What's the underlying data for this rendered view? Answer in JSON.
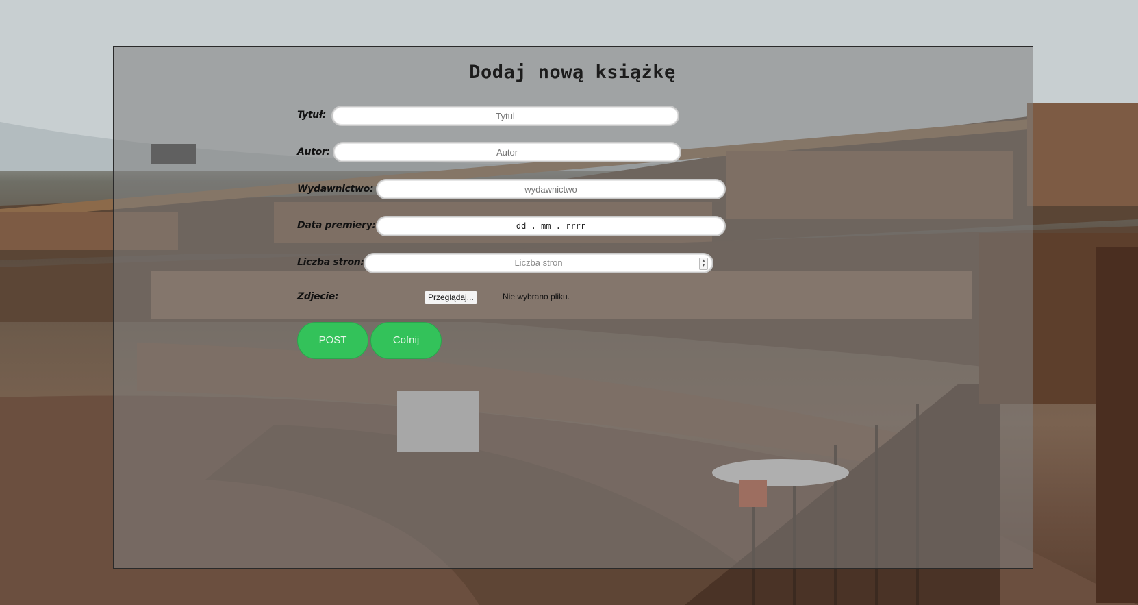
{
  "page": {
    "title": "Dodaj nową książkę"
  },
  "form": {
    "title": {
      "label": "Tytuł:",
      "placeholder": "Tytul"
    },
    "author": {
      "label": "Autor:",
      "placeholder": "Autor"
    },
    "publisher": {
      "label": "Wydawnictwo:",
      "placeholder": "wydawnictwo"
    },
    "release_date": {
      "label": "Data premiery:",
      "placeholder": "dd . mm . rrrr"
    },
    "pages": {
      "label": "Liczba stron:",
      "placeholder": "Liczba stron"
    },
    "photo": {
      "label": "Zdjecie:",
      "browse_label": "Przeglądaj...",
      "status_text": "Nie wybrano pliku."
    }
  },
  "actions": {
    "post_label": "POST",
    "back_label": "Cofnij"
  },
  "colors": {
    "button": "#33c25a",
    "panel_overlay": "rgba(128,128,128,0.55)"
  },
  "icons": {
    "number_spinner": "spinner-arrows-icon"
  }
}
